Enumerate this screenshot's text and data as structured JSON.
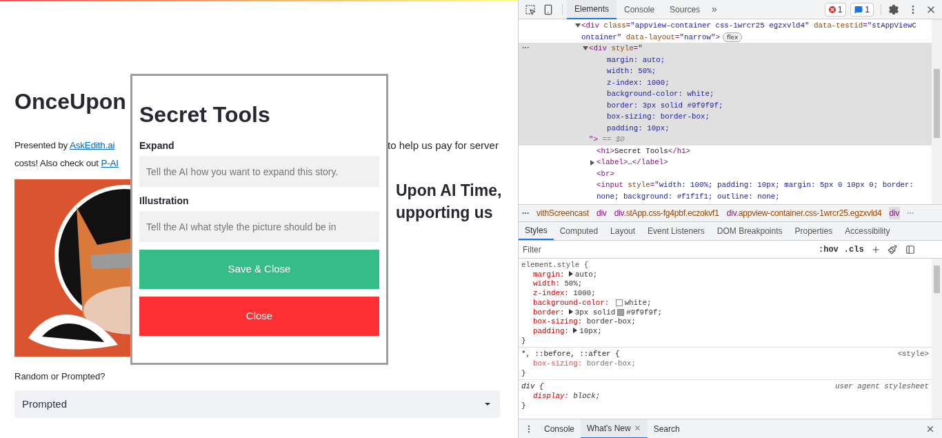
{
  "page": {
    "title": "OnceUpon",
    "intro_left": [
      "Presented by ",
      "costs! Also check out "
    ],
    "links": [
      "AskEdith.ai",
      "P-AI"
    ],
    "intro_right": "to help us pay for server",
    "heading_right": [
      "Upon AI Time,",
      "upporting us"
    ],
    "select": {
      "label": "Random or Prompted?",
      "value": "Prompted"
    }
  },
  "modal": {
    "title": "Secret Tools",
    "fields": [
      {
        "label": "Expand",
        "placeholder": "Tell the AI how you want to expand this story."
      },
      {
        "label": "Illustration",
        "placeholder": "Tell the AI what style the picture should be in"
      }
    ],
    "buttons": [
      {
        "label": "Save & Close",
        "kind": "primary"
      },
      {
        "label": "Close",
        "kind": "danger"
      }
    ]
  },
  "devtools": {
    "tabs": [
      {
        "label": "Elements",
        "selected": true
      },
      {
        "label": "Console",
        "selected": false
      },
      {
        "label": "Sources",
        "selected": false
      }
    ],
    "more": "»",
    "error_count": "1",
    "message_count": "1",
    "dom": [
      {
        "expanded": true,
        "selected": false,
        "badge": "flex",
        "lines": [
          [
            {
              "kind": "tag",
              "t": "<div "
            },
            {
              "kind": "attr",
              "t": "class"
            },
            {
              "kind": "tag",
              "t": "="
            },
            {
              "kind": "value",
              "t": "\"appview-container css-1wrcr25 egzxvld4\""
            },
            {
              "kind": "attr",
              "t": " data-testid"
            },
            {
              "kind": "tag",
              "t": "="
            },
            {
              "kind": "value",
              "t": "\"stAppViewC"
            }
          ],
          [
            {
              "kind": "value",
              "t": "ontainer\""
            },
            {
              "kind": "attr",
              "t": " data-layout"
            },
            {
              "kind": "tag",
              "t": "="
            },
            {
              "kind": "value",
              "t": "\"narrow\""
            },
            {
              "kind": "tag",
              "t": ">"
            }
          ]
        ],
        "children": [
          {
            "expanded": true,
            "selected": true,
            "lines": [
              [
                {
                  "kind": "tag",
                  "t": "<div "
                },
                {
                  "kind": "attr",
                  "t": "style"
                },
                {
                  "kind": "tag",
                  "t": "="
                },
                {
                  "kind": "value",
                  "t": "\""
                }
              ],
              [
                {
                  "kind": "value",
                  "t": "    margin: auto;"
                }
              ],
              [
                {
                  "kind": "value",
                  "t": "    width: 50%;"
                }
              ],
              [
                {
                  "kind": "value",
                  "t": "    z-index: 1000;"
                }
              ],
              [
                {
                  "kind": "value",
                  "t": "    background-color: white;"
                }
              ],
              [
                {
                  "kind": "value",
                  "t": "    border: 3px solid #9f9f9f;"
                }
              ],
              [
                {
                  "kind": "value",
                  "t": "    box-sizing: border-box;"
                }
              ],
              [
                {
                  "kind": "value",
                  "t": "    padding: 10px;"
                }
              ],
              [
                {
                  "kind": "tag",
                  "t": "\">"
                },
                {
                  "kind": "hint",
                  "t": " == $0"
                }
              ]
            ],
            "children": [
              {
                "selected": false,
                "lines": [
                  [
                    {
                      "kind": "tag",
                      "t": "<h1>"
                    },
                    {
                      "kind": "text",
                      "t": "Secret Tools"
                    },
                    {
                      "kind": "tag",
                      "t": "</h1>"
                    }
                  ]
                ]
              },
              {
                "expanded": false,
                "selected": false,
                "lines": [
                  [
                    {
                      "kind": "tag",
                      "t": "<label>"
                    },
                    {
                      "kind": "text",
                      "t": "…"
                    },
                    {
                      "kind": "tag",
                      "t": "</label>"
                    }
                  ]
                ]
              },
              {
                "selected": false,
                "lines": [
                  [
                    {
                      "kind": "tag",
                      "t": "<br>"
                    }
                  ]
                ]
              },
              {
                "selected": false,
                "lines": [
                  [
                    {
                      "kind": "tag",
                      "t": "<input "
                    },
                    {
                      "kind": "attr",
                      "t": "style"
                    },
                    {
                      "kind": "tag",
                      "t": "="
                    },
                    {
                      "kind": "value",
                      "t": "\"width: 100%; padding: 10px; margin: 5px 0 10px 0; border:"
                    }
                  ],
                  [
                    {
                      "kind": "value",
                      "t": "none; background: #f1f1f1; outline: none;"
                    }
                  ]
                ]
              }
            ]
          }
        ]
      }
    ],
    "breadcrumbs": [
      {
        "cls": "vithScreencast",
        "selected": false
      },
      {
        "tag": "div",
        "selected": false
      },
      {
        "tag": "div",
        "cls": ".stApp.css-fg4pbf.eczokvf1",
        "selected": false
      },
      {
        "tag": "div",
        "cls": ".appview-container.css-1wrcr25.egzxvld4",
        "selected": false
      },
      {
        "tag": "div",
        "selected": true
      }
    ],
    "subtabs": [
      {
        "label": "Styles",
        "selected": true
      },
      {
        "label": "Computed",
        "selected": false
      },
      {
        "label": "Layout",
        "selected": false
      },
      {
        "label": "Event Listeners",
        "selected": false
      },
      {
        "label": "DOM Breakpoints",
        "selected": false
      },
      {
        "label": "Properties",
        "selected": false
      },
      {
        "label": "Accessibility",
        "selected": false
      }
    ],
    "filter": {
      "placeholder": "Filter"
    },
    "filter_buttons": [
      ":hov",
      ".cls"
    ],
    "rules": [
      {
        "selector": "element.style {",
        "close": "}",
        "kind": "inline",
        "props": [
          {
            "name": "margin:",
            "value": "auto;",
            "expandable": true,
            "overridden": false
          },
          {
            "name": "width:",
            "value": "50%;",
            "expandable": false,
            "overridden": false
          },
          {
            "name": "z-index:",
            "value": "1000;",
            "expandable": false,
            "overridden": false
          },
          {
            "name": "background-color:",
            "color": "#ffffff",
            "value2": "white;",
            "expandable": false,
            "overridden": false
          },
          {
            "name": "border:",
            "value": "3px solid",
            "color": "#9f9f9f",
            "value2": "#9f9f9f;",
            "expandable": true,
            "overridden": false
          },
          {
            "name": "box-sizing:",
            "value": "border-box;",
            "expandable": false,
            "overridden": false
          },
          {
            "name": "padding:",
            "value": "10px;",
            "expandable": true,
            "overridden": false
          }
        ]
      },
      {
        "selector": "*, ::before, ::after {",
        "close": "}",
        "source": "<style>",
        "kind": "author",
        "props": [
          {
            "name": "box-sizing:",
            "value": "border-box;",
            "expandable": false,
            "overridden": true
          }
        ]
      },
      {
        "selector": "div {",
        "close": "}",
        "source": "user agent stylesheet",
        "kind": "ua",
        "props": [
          {
            "name": "display:",
            "value": "block;",
            "expandable": false,
            "overridden": false
          }
        ]
      }
    ],
    "drawer_tabs": [
      {
        "label": "Console",
        "selected": false,
        "closable": false
      },
      {
        "label": "What's New",
        "selected": true,
        "closable": true
      },
      {
        "label": "Search",
        "selected": false,
        "closable": false
      }
    ]
  }
}
